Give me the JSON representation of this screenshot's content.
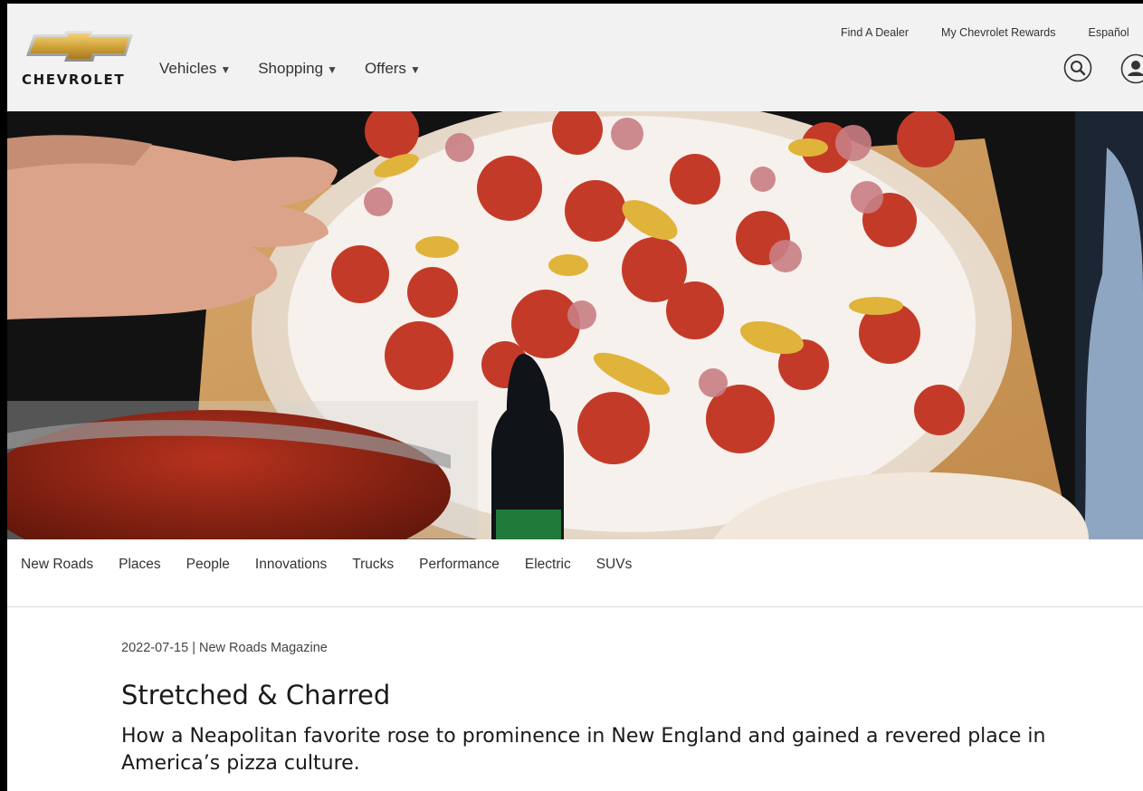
{
  "brand": {
    "name": "CHEVROLET",
    "gold": "#d1a43c",
    "icon": "chevrolet-bowtie-icon"
  },
  "utility_nav": {
    "find_dealer": "Find A Dealer",
    "rewards": "My Chevrolet Rewards",
    "language": "Español"
  },
  "main_nav": [
    {
      "label": "Vehicles",
      "caret": "▼"
    },
    {
      "label": "Shopping",
      "caret": "▼"
    },
    {
      "label": "Offers",
      "caret": "▼"
    }
  ],
  "header_icons": {
    "search": "search-icon",
    "account": "user-account-icon"
  },
  "hero": {
    "subject": "pizza-photo"
  },
  "categories": [
    "New Roads",
    "Places",
    "People",
    "Innovations",
    "Trucks",
    "Performance",
    "Electric",
    "SUVs"
  ],
  "article": {
    "meta": "2022-07-15 | New Roads Magazine",
    "title": "Stretched & Charred",
    "subtitle": "How a Neapolitan favorite rose to prominence in New England and gained a revered place in America’s pizza culture."
  }
}
